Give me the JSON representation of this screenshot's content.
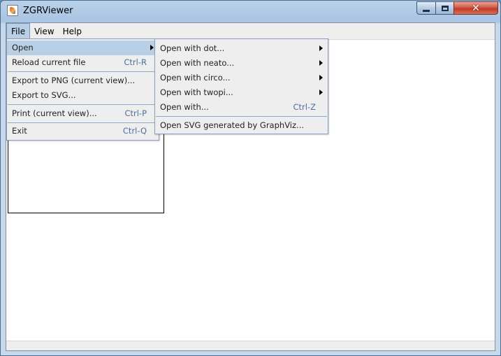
{
  "window": {
    "title": "ZGRViewer",
    "close_glyph": "✕"
  },
  "menubar": {
    "items": [
      "File",
      "View",
      "Help"
    ]
  },
  "file_menu": {
    "items": [
      {
        "label": "Open",
        "accel": "",
        "submenu": true
      },
      {
        "label": "Reload current file",
        "accel": "Ctrl-R"
      },
      {
        "label": "Export to PNG (current view)...",
        "accel": ""
      },
      {
        "label": "Export to SVG...",
        "accel": ""
      },
      {
        "label": "Print (current view)...",
        "accel": "Ctrl-P"
      },
      {
        "label": "Exit",
        "accel": "Ctrl-Q"
      }
    ]
  },
  "open_submenu": {
    "items": [
      {
        "label": "Open with dot...",
        "accel": "",
        "submenu": true
      },
      {
        "label": "Open with neato...",
        "accel": "",
        "submenu": true
      },
      {
        "label": "Open with circo...",
        "accel": "",
        "submenu": true
      },
      {
        "label": "Open with twopi...",
        "accel": "",
        "submenu": true
      },
      {
        "label": "Open with...",
        "accel": "Ctrl-Z"
      },
      {
        "label": "Open SVG generated by GraphViz...",
        "accel": ""
      }
    ]
  }
}
